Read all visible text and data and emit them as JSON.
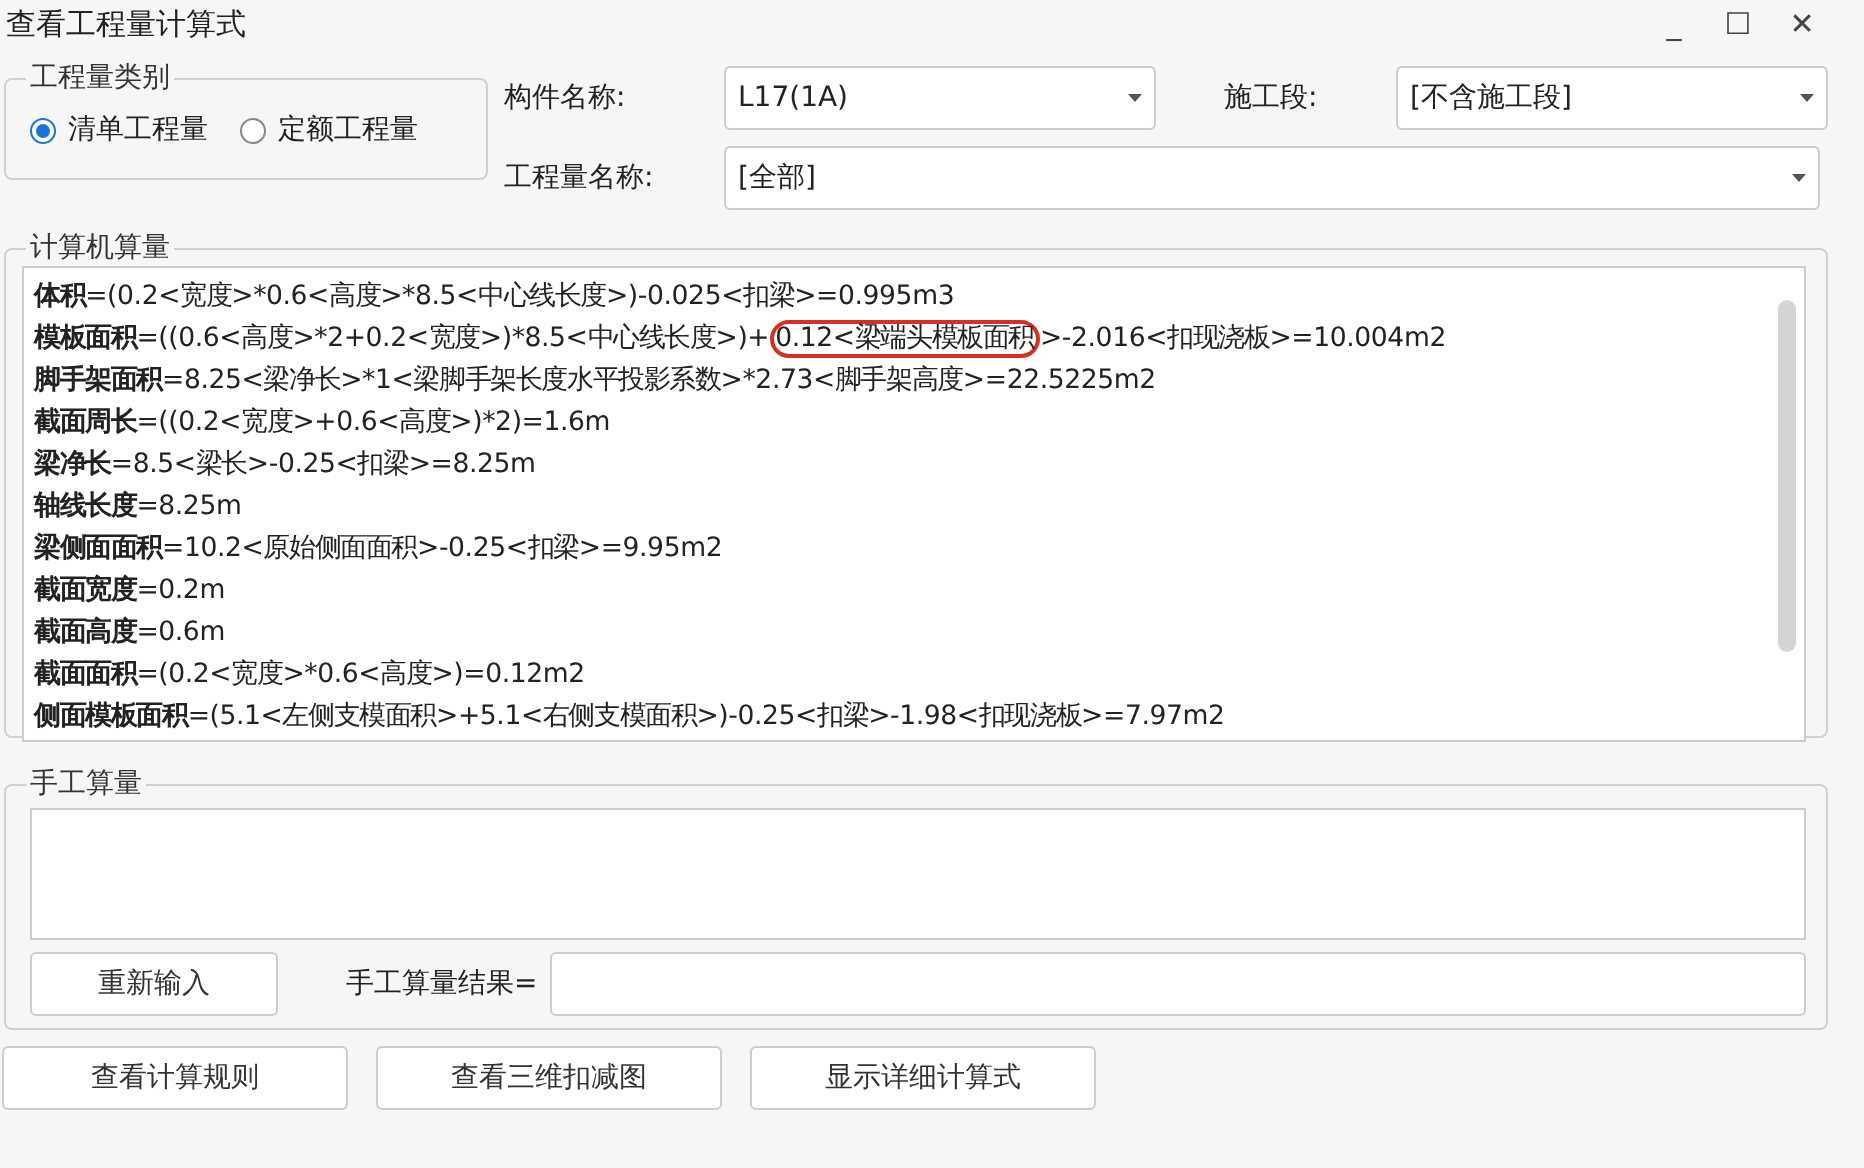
{
  "window": {
    "title": "查看工程量计算式",
    "controls": [
      "_",
      "☐",
      "✕"
    ]
  },
  "quantity_type": {
    "legend": "工程量类别",
    "options": [
      {
        "label": "清单工程量",
        "selected": true
      },
      {
        "label": "定额工程量",
        "selected": false
      }
    ]
  },
  "component": {
    "label": "构件名称:",
    "value": "L17(1A)"
  },
  "stage": {
    "label": "施工段:",
    "value": "[不含施工段]"
  },
  "quantity_name": {
    "label": "工程量名称:",
    "value": "[全部]"
  },
  "computed": {
    "legend": "计算机算量",
    "lines": [
      {
        "text": "**体积**=(0.2<宽度>*0.6<高度>*8.5<中心线长度>)-0.025<扣梁>=0.995m3"
      },
      {
        "text": "**模板面积**=((0.6<高度>*2+0.2<宽度>)*8.5<中心线长度>)+",
        "circled": "0.12<梁端头模板面积",
        "after": ">-2.016<扣现浇板>=10.004m2"
      },
      {
        "text": "**脚手架面积**=8.25<梁净长>*1<梁脚手架长度水平投影系数>*2.73<脚手架高度>=22.5225m2"
      },
      {
        "text": "**截面周长**=((0.2<宽度>+0.6<高度>)*2)=1.6m"
      },
      {
        "text": "**梁净长**=8.5<梁长>-0.25<扣梁>=8.25m"
      },
      {
        "text": "**轴线长度**=8.25m"
      },
      {
        "text": "**梁侧面面积**=10.2<原始侧面面积>-0.25<扣梁>=9.95m2"
      },
      {
        "text": "**截面宽度**=0.2m"
      },
      {
        "text": "**截面高度**=0.6m"
      },
      {
        "text": "**截面面积**=(0.2<宽度>*0.6<高度>)=0.12m2"
      },
      {
        "text": "**侧面模板面积**=(5.1<左侧支模面积>+5.1<右侧支模面积>)-0.25<扣梁>-1.98<扣现浇板>=7.97m2"
      }
    ]
  },
  "manual": {
    "legend": "手工算量",
    "reenter_button": "重新输入",
    "result_label": "手工算量结果="
  },
  "buttons": [
    "查看计算规则",
    "查看三维扣减图",
    "显示详细计算式"
  ]
}
